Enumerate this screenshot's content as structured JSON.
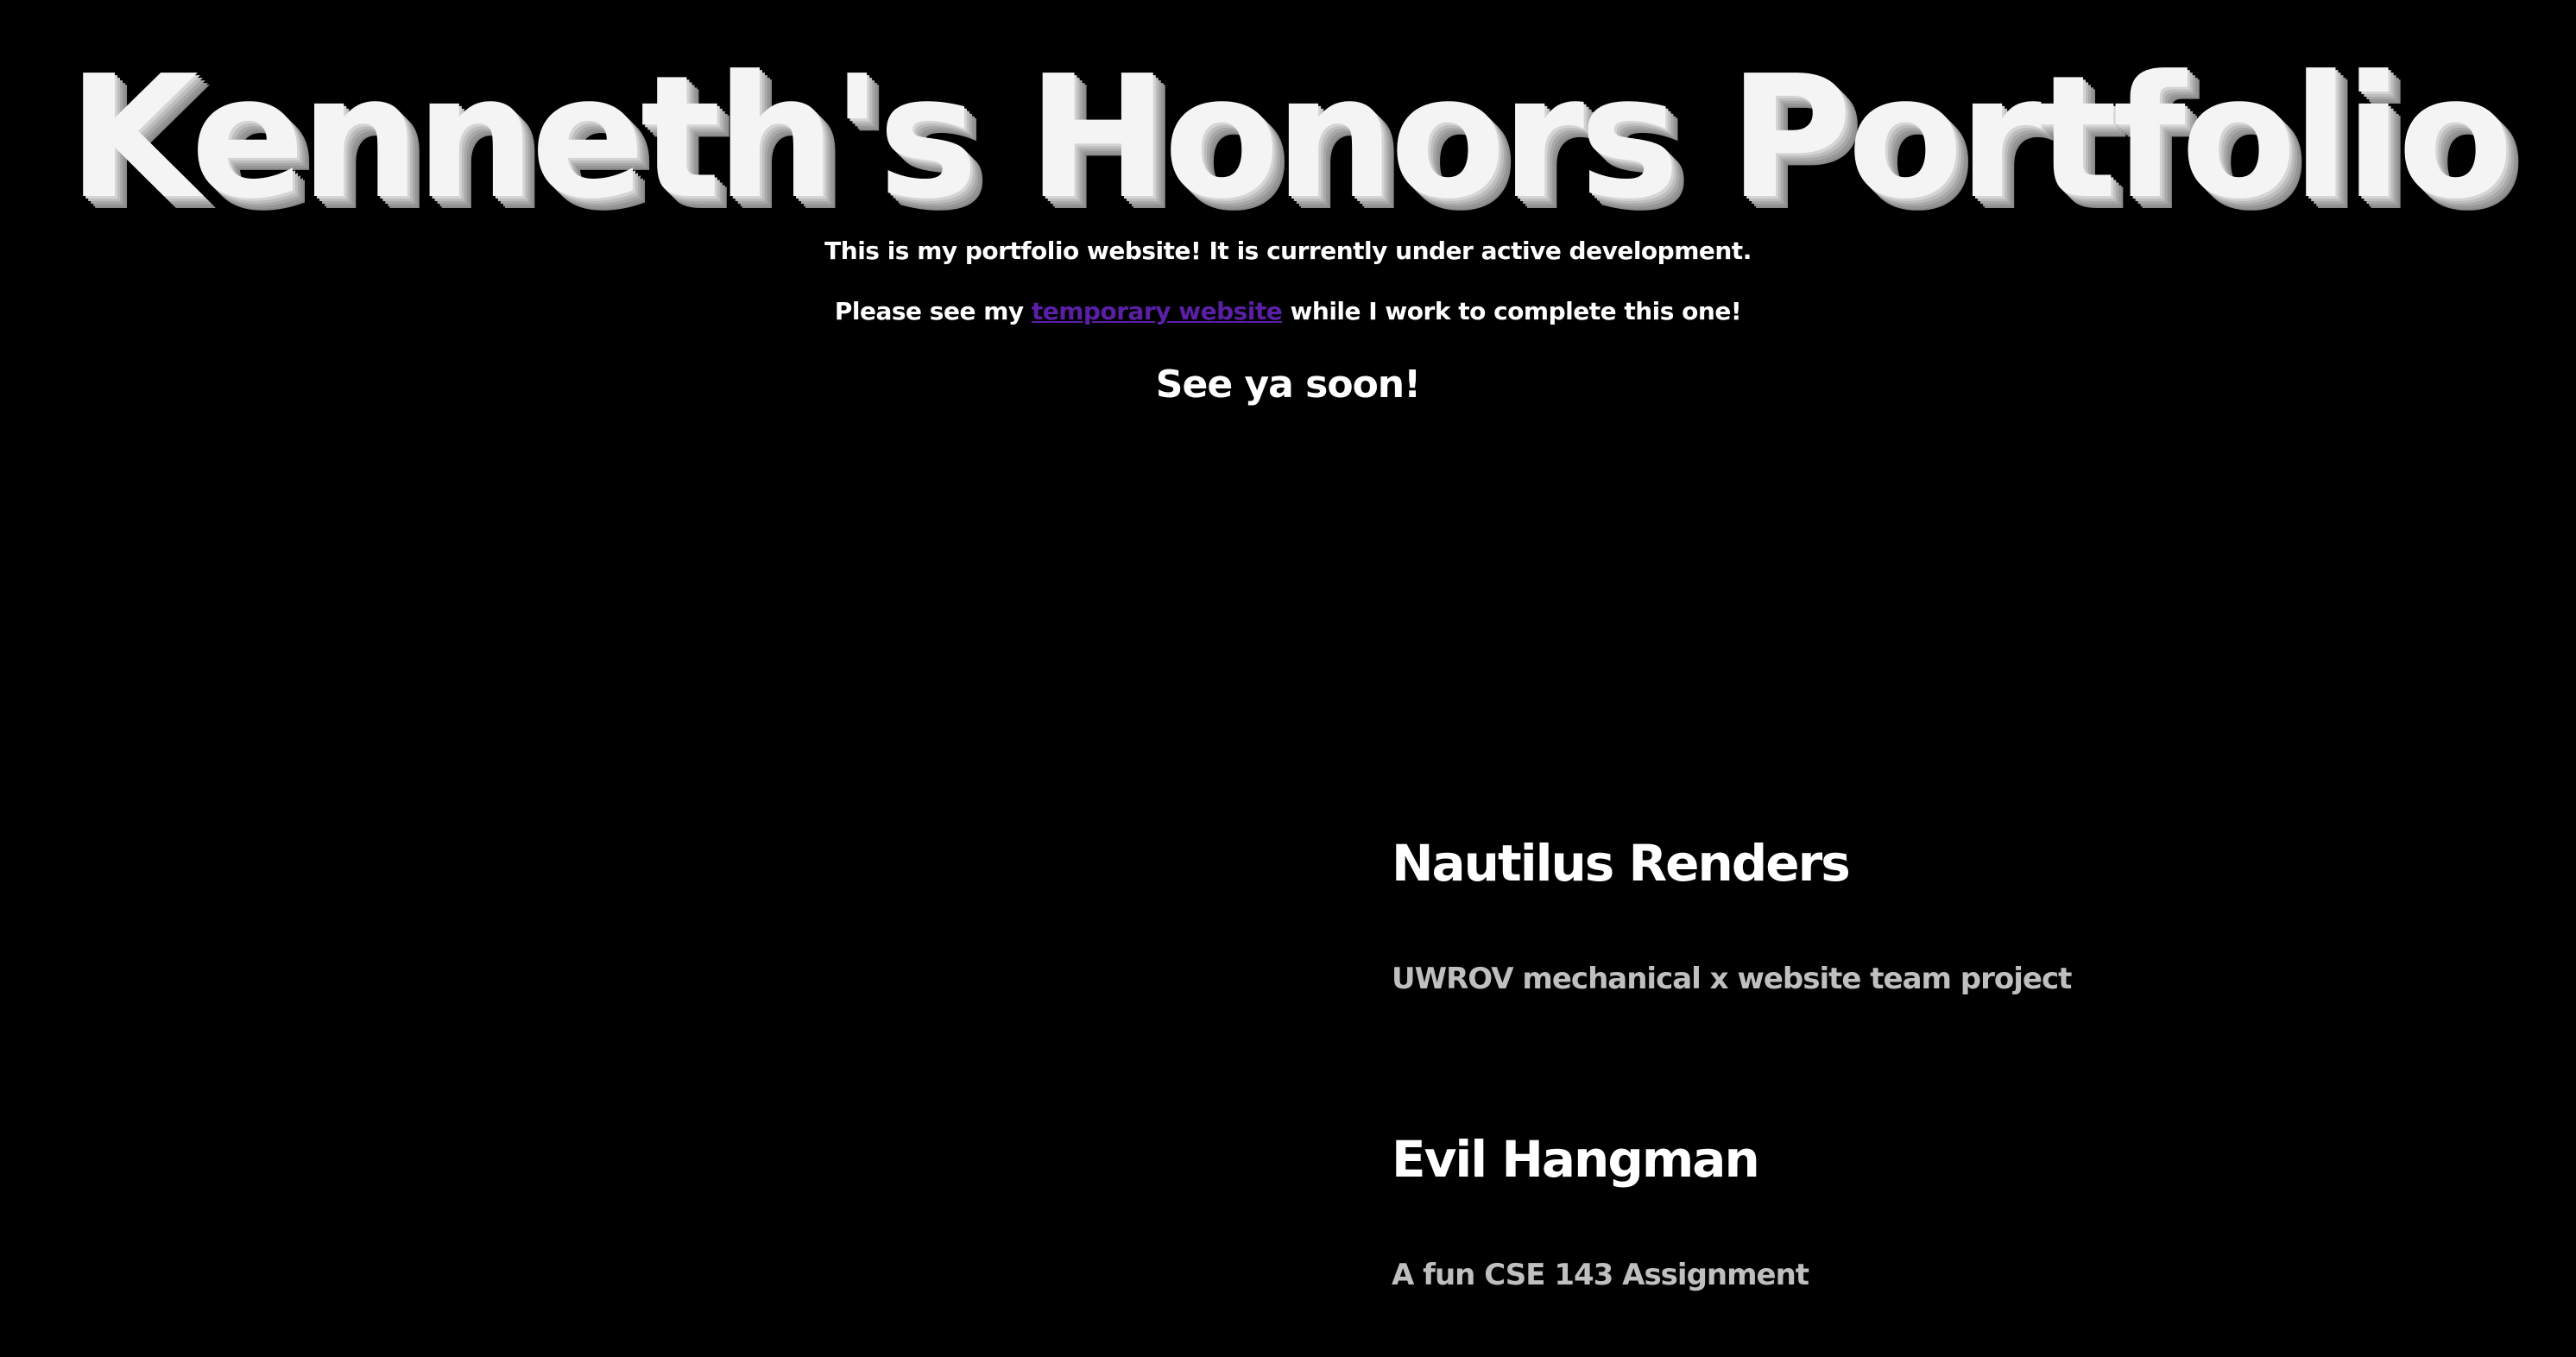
{
  "header": {
    "title": "Kenneth's Honors Portfolio"
  },
  "intro": {
    "line1": "This is my portfolio website! It is currently under active development.",
    "line2_before": "Please see my ",
    "line2_link": "temporary website",
    "line2_after": " while I work to complete this one!",
    "sign_off": "See ya soon!"
  },
  "projects": [
    {
      "title": "Nautilus Renders",
      "description": "UWROV mechanical x website team project"
    },
    {
      "title": "Evil Hangman",
      "description": "A fun CSE 143 Assignment"
    }
  ],
  "colors": {
    "background": "#000000",
    "text": "#ffffff",
    "link": "#5b1fa6",
    "muted": "#bfbfbf"
  }
}
